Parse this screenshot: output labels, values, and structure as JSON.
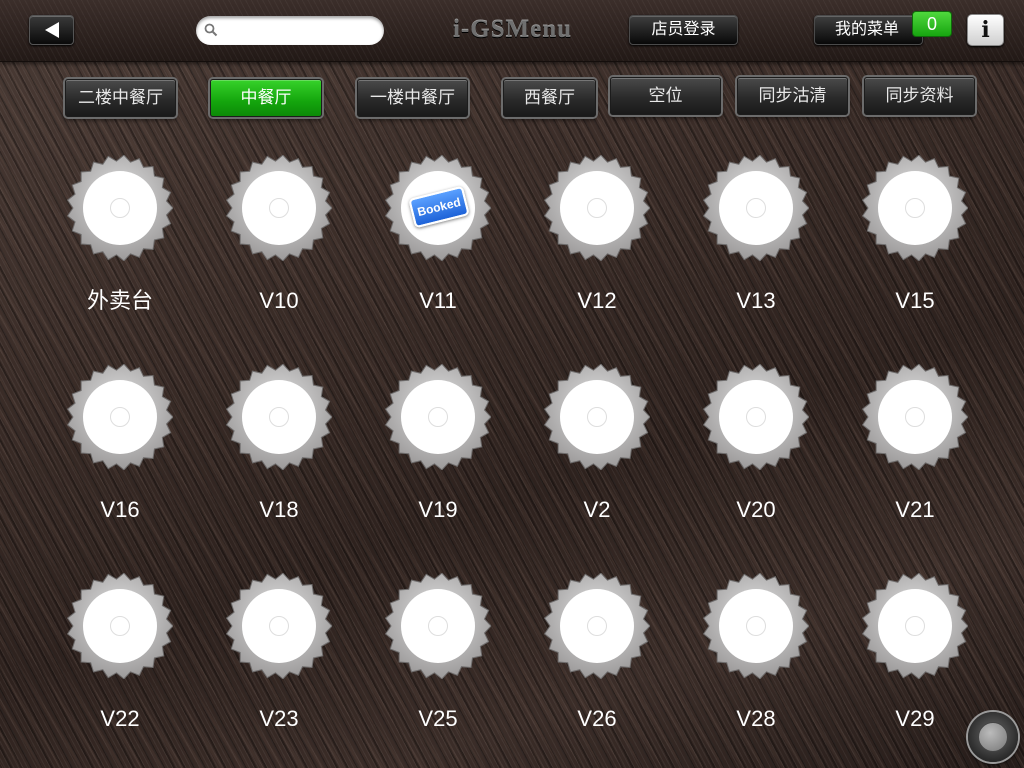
{
  "topbar": {
    "search": {
      "placeholder": "",
      "value": ""
    },
    "app_title": "i-GSMenu",
    "login_label": "店员登录",
    "my_menu_label": "我的菜单",
    "my_menu_count": "0",
    "info_label": "i"
  },
  "tabs": [
    {
      "label": "二楼中餐厅",
      "active": false
    },
    {
      "label": "中餐厅",
      "active": true
    },
    {
      "label": "一楼中餐厅",
      "active": false
    },
    {
      "label": "西餐厅",
      "active": false
    },
    {
      "label": "空位",
      "active": false
    },
    {
      "label": "同步沽清",
      "active": false
    },
    {
      "label": "同步资料",
      "active": false
    }
  ],
  "tables": [
    {
      "name": "外卖台",
      "booked": false
    },
    {
      "name": "V10",
      "booked": false
    },
    {
      "name": "V11",
      "booked": true,
      "badge": "Booked"
    },
    {
      "name": "V12",
      "booked": false
    },
    {
      "name": "V13",
      "booked": false
    },
    {
      "name": "V15",
      "booked": false
    },
    {
      "name": "V16",
      "booked": false
    },
    {
      "name": "V18",
      "booked": false
    },
    {
      "name": "V19",
      "booked": false
    },
    {
      "name": "V2",
      "booked": false
    },
    {
      "name": "V20",
      "booked": false
    },
    {
      "name": "V21",
      "booked": false
    },
    {
      "name": "V22",
      "booked": false
    },
    {
      "name": "V23",
      "booked": false
    },
    {
      "name": "V25",
      "booked": false
    },
    {
      "name": "V26",
      "booked": false
    },
    {
      "name": "V28",
      "booked": false
    },
    {
      "name": "V29",
      "booked": false
    }
  ],
  "colors": {
    "active_tab": "#14a50d",
    "badge_green": "#17a510",
    "booked_blue": "#1e63d8",
    "cap_gray": "#bdbdbd"
  }
}
